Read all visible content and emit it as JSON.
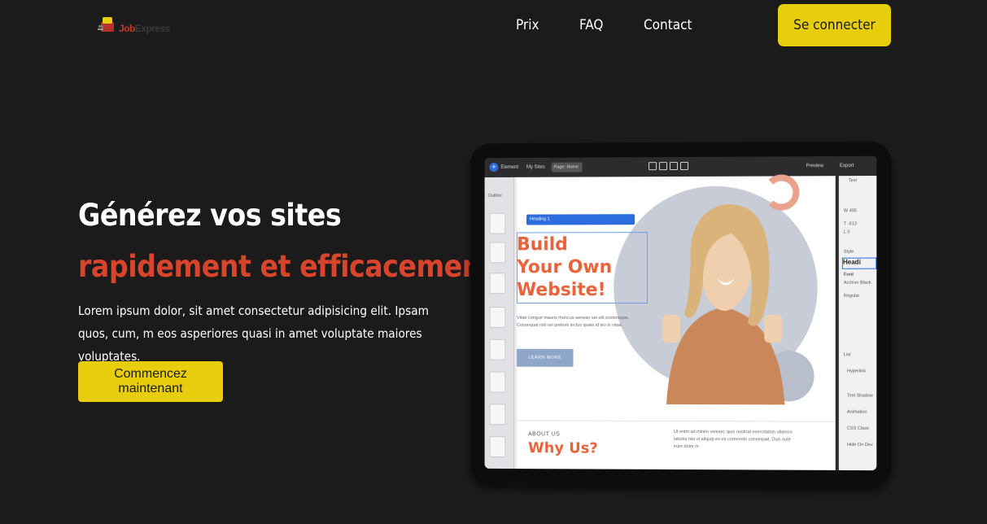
{
  "brand": {
    "logo_part1": "Job",
    "logo_part2": "Express"
  },
  "nav": {
    "links": [
      "Prix",
      "FAQ",
      "Contact"
    ],
    "login_label": "Se connecter"
  },
  "hero": {
    "title_line1": "Générez vos sites",
    "title_line2": "rapidement et efficacement",
    "description": "Lorem ipsum dolor, sit amet consectetur adipisicing elit. Ipsam quos, cum, m eos asperiores quasi in amet voluptate maiores voluptates.",
    "cta_label": "Commencez maintenant"
  },
  "mockup": {
    "editor": {
      "element_menu": "Element",
      "my_sites": "My Sites",
      "page": "Page: Home",
      "preview": "Preview",
      "export": "Export",
      "outline": "Outline",
      "toolbar_heading": "Heading 1",
      "panel_text": "Text",
      "panel_w": "W  495",
      "panel_t": "T  -613",
      "panel_l": "L  0",
      "panel_style": "Style",
      "panel_heading": "Headi",
      "panel_font": "Font",
      "panel_font_name": "Archivo Black",
      "panel_weight": "Regular",
      "panel_list": "List",
      "panel_hyperlink": "Hyperlink",
      "panel_text_shadow": "Text Shadow",
      "panel_animation": "Animation",
      "panel_css_class": "CSS Class",
      "panel_hide": "Hide On Dev"
    },
    "site": {
      "headline_1": "Build",
      "headline_2": "Your Own",
      "headline_3": "Website!",
      "body": "Vitae congue mauris rhoncus aenean vel elit scelerisque. Consequat nisl vel pretium lectus quam id leo in vitae.",
      "button": "LEARN MORE",
      "about": "ABOUT US",
      "why": "Why Us?",
      "about_body": "Ut enim ad minim veniam, quis nostrud exercitation ullamco laboris nisi ut aliquip ex ea commodo consequat. Duis aute irure dolor in"
    }
  },
  "colors": {
    "background": "#1b1b1b",
    "accent_yellow": "#e8cd0c",
    "accent_red": "#d9442c",
    "site_orange": "#e8623a"
  }
}
